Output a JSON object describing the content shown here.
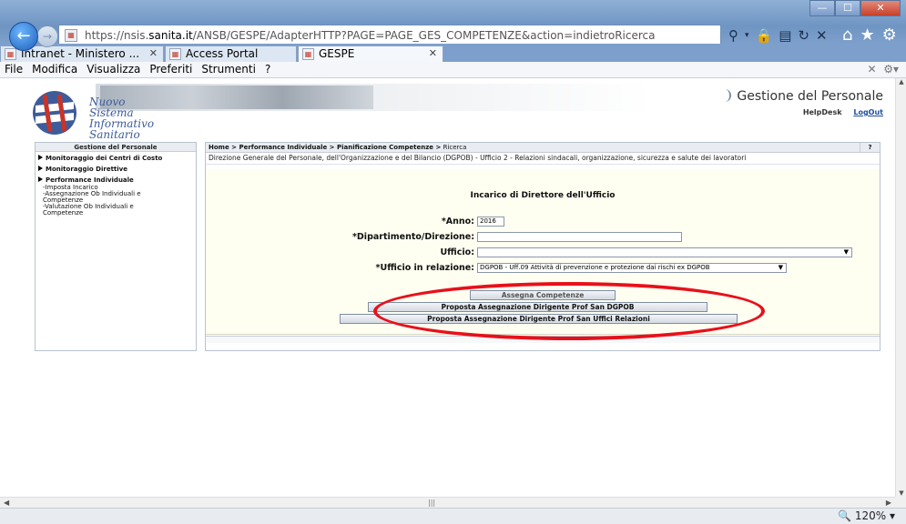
{
  "browser": {
    "url_prefix": "https://nsis.",
    "url_host": "sanita.it",
    "url_rest": "/ANSB/GESPE/AdapterHTTP?PAGE=PAGE_GES_COMPETENZE&action=indietroRicerca",
    "tabs": [
      {
        "label": "Intranet - Ministero ..."
      },
      {
        "label": "Access Portal"
      },
      {
        "label": "GESPE"
      }
    ],
    "menu": [
      "File",
      "Modifica",
      "Visualizza",
      "Preferiti",
      "Strumenti",
      "?"
    ],
    "zoom": "120%",
    "back_glyph": "←",
    "fwd_glyph": "→"
  },
  "header": {
    "logo_line1": "Nuovo",
    "logo_line2": "Sistema",
    "logo_line3": "Informativo",
    "logo_line4": "Sanitario",
    "app_title": "Gestione del Personale",
    "help": "HelpDesk",
    "logout": "LogOut"
  },
  "sidebar": {
    "title": "Gestione del Personale",
    "items": [
      {
        "label": "Monitoraggio dei Centri di Costo"
      },
      {
        "label": "Monitoraggio Direttive"
      },
      {
        "label": "Performance Individuale"
      }
    ],
    "subitems": [
      "-Imposta Incarico",
      "-Assegnazione Ob Individuali e",
      "Competenze",
      "-Valutazione Ob Individuali e",
      "Competenze"
    ]
  },
  "main": {
    "breadcrumb": "Home > Performance Individuale > Pianificazione Competenze >",
    "breadcrumb_current": "Ricerca",
    "help_mark": "?",
    "subtitle": "Direzione Generale del Personale, dell'Organizzazione e del Bilancio (DGPOB) - Ufficio 2 - Relazioni sindacali, organizzazione, sicurezza e salute dei lavoratori",
    "form_title": "Incarico di Direttore dell'Ufficio",
    "fields": {
      "anno_label": "*Anno:",
      "anno_value": "2016",
      "dipartimento_label": "*Dipartimento/Direzione:",
      "ufficio_label": "Ufficio:",
      "ufficio_rel_label": "*Ufficio in relazione:",
      "ufficio_rel_value": "DGPOB - Uff.09 Attività di prevenzione e protezione dai rischi ex DGPOB"
    },
    "buttons": {
      "assegna": "Assegna Competenze",
      "proposta_dgpob": "Proposta Assegnazione Dirigente Prof San DGPOB",
      "proposta_uffici": "Proposta Assegnazione Dirigente Prof San Uffici Relazioni"
    }
  },
  "annotation_color": "#e8101a"
}
